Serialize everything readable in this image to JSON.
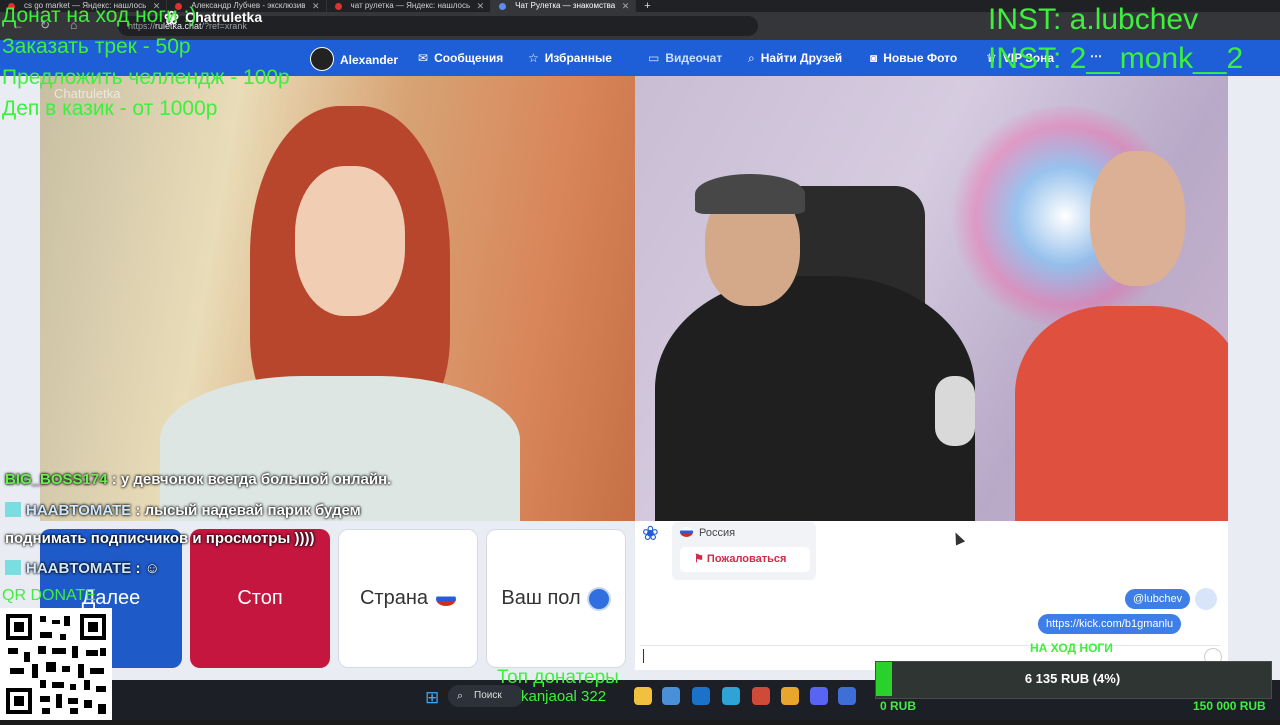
{
  "browser": {
    "tabs": [
      {
        "label": "cs go market — Яндекс: нашлось"
      },
      {
        "label": "Александр Лубчев - эксклюзив"
      },
      {
        "label": "чат рулетка — Яндекс: нашлось"
      },
      {
        "label": "Чат Рулетка — знакомства"
      }
    ],
    "url_prefix": "https://",
    "url_host": "ruletka.chat",
    "url_path": "/?ref=xrank"
  },
  "site": {
    "logo": "Chatruletka",
    "user": "Alexander",
    "nav": {
      "messages": "Сообщения",
      "favorites": "Избранные",
      "videochat": "Видеочат",
      "find_friends": "Найти Друзей",
      "new_photos": "Новые Фото",
      "vip": "VIP Зона"
    },
    "watermark": "Chatruletka"
  },
  "controls": {
    "next": "Далее",
    "stop": "Стоп",
    "country": "Страна",
    "gender": "Ваш пол"
  },
  "chat": {
    "partner_country": "Россия",
    "report": "Пожаловаться",
    "messages": [
      {
        "text": "@lubchev"
      },
      {
        "text": "https://kick.com/b1gmanlu"
      }
    ]
  },
  "overlay": {
    "donations": [
      "Донат на ход ноги :)",
      "Заказать трек - 50р",
      "Предложить челлендж - 100р",
      "Деп в казик - от 1000р"
    ],
    "inst": [
      "INST: a.lubchev",
      "INST: 2__monk__2"
    ],
    "stream_chat": [
      {
        "nick": "BIG_BOSS174",
        "text": ": у девчонок всегда большой онлайн."
      },
      {
        "nick": "HAABTOMATE",
        "text": ": лысый надевай парик будем"
      },
      {
        "nick": "",
        "text": "поднимать подписчиков и просмотры ))))"
      },
      {
        "nick": "HAABTOMATE",
        "text": ":"
      }
    ],
    "qr_label": "QR DONATE",
    "top_donors_title": "Топ донатеры",
    "top_donor": "kanjaoal 322",
    "goal_title": "НА ХОД НОГИ",
    "goal_text": "6 135 RUB (4%)",
    "goal_progress": 0.04,
    "goal_min": "0 RUB",
    "goal_max": "150 000 RUB"
  },
  "taskbar": {
    "search": "Поиск"
  },
  "colors": {
    "header_blue": "#1e5ed6",
    "stop_red": "#c4163f",
    "overlay_green": "#3cf03c"
  }
}
